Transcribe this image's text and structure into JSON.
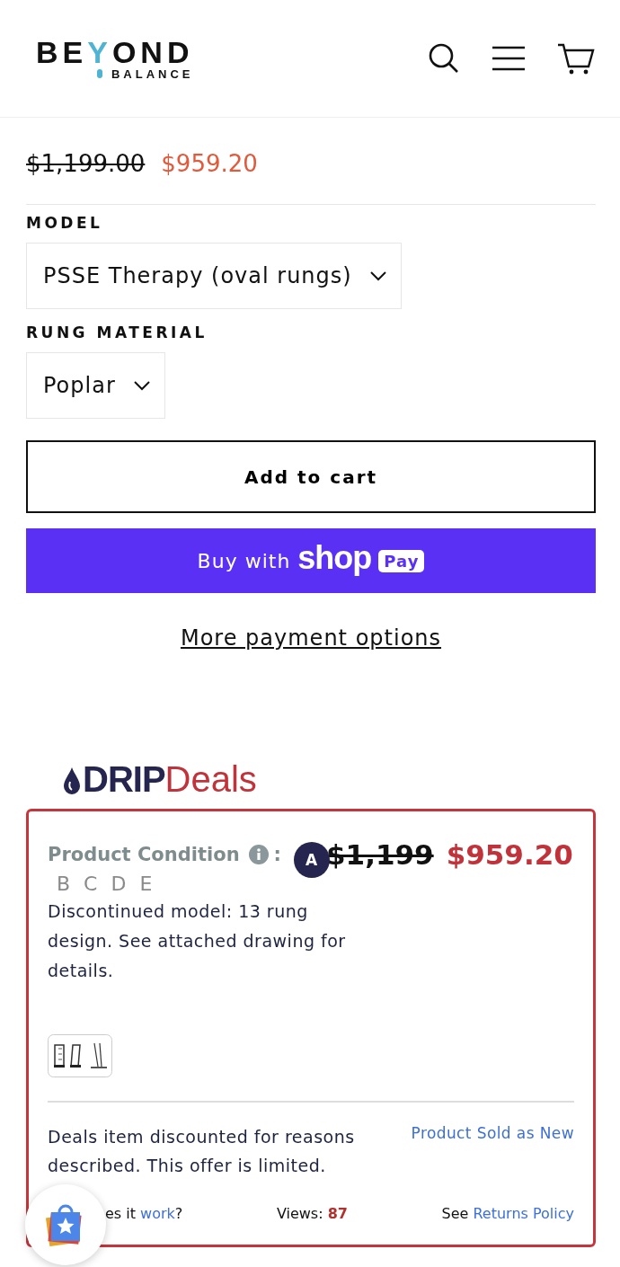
{
  "header": {
    "logo_top_left": "BE",
    "logo_top_mid": "Y",
    "logo_top_right": "OND",
    "logo_bottom": "BALANCE"
  },
  "price": {
    "compare_at": "$1,199.00",
    "sale": "$959.20"
  },
  "options": [
    {
      "label": "MODEL",
      "value": "PSSE Therapy (oval rungs)"
    },
    {
      "label": "RUNG MATERIAL",
      "value": "Poplar"
    }
  ],
  "add_to_cart": "Add to cart",
  "shop_pay": {
    "prefix": "Buy with",
    "brand": "shop",
    "pay": "Pay"
  },
  "more_payment": "More payment options",
  "drip": {
    "logo_bold": "DRIP",
    "logo_light": "Deals",
    "condition_label": "Product Condition",
    "colon": ":",
    "grades": [
      {
        "letter": "A",
        "selected": true
      },
      {
        "letter": "B",
        "selected": false
      },
      {
        "letter": "C",
        "selected": false
      },
      {
        "letter": "D",
        "selected": false
      },
      {
        "letter": "E",
        "selected": false
      }
    ],
    "compare_at": "$1,199",
    "price": "$959.20",
    "description": "Discontinued model: 13 rung design. See attached drawing for details.",
    "note": "Deals item discounted for reasons described. This offer is limited.",
    "sold_as": "Product Sold as New",
    "how_prefix": "es it",
    "how_link": "work",
    "how_suffix": "?",
    "views_label": "Views:",
    "views": "87",
    "returns_prefix": "See",
    "returns_link": "Returns Policy"
  }
}
